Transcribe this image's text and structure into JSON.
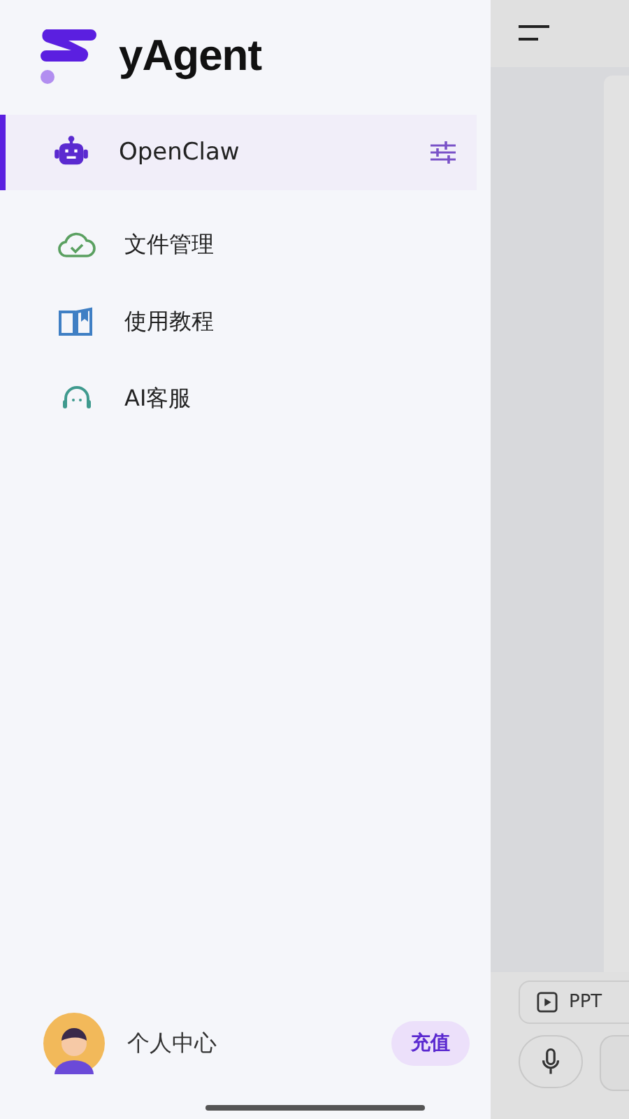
{
  "drawer": {
    "logo": "yAgent",
    "menu": [
      {
        "label": "OpenClaw",
        "kind": "robot",
        "selected": true,
        "has_settings": true
      },
      {
        "label": "文件管理",
        "kind": "cloud",
        "selected": false,
        "has_settings": false
      },
      {
        "label": "使用教程",
        "kind": "book",
        "selected": false,
        "has_settings": false
      },
      {
        "label": "AI客服",
        "kind": "headset",
        "selected": false,
        "has_settings": false
      }
    ],
    "profile": {
      "label": "个人中心",
      "action": "充值"
    }
  },
  "background": {
    "chip": "PPT"
  }
}
